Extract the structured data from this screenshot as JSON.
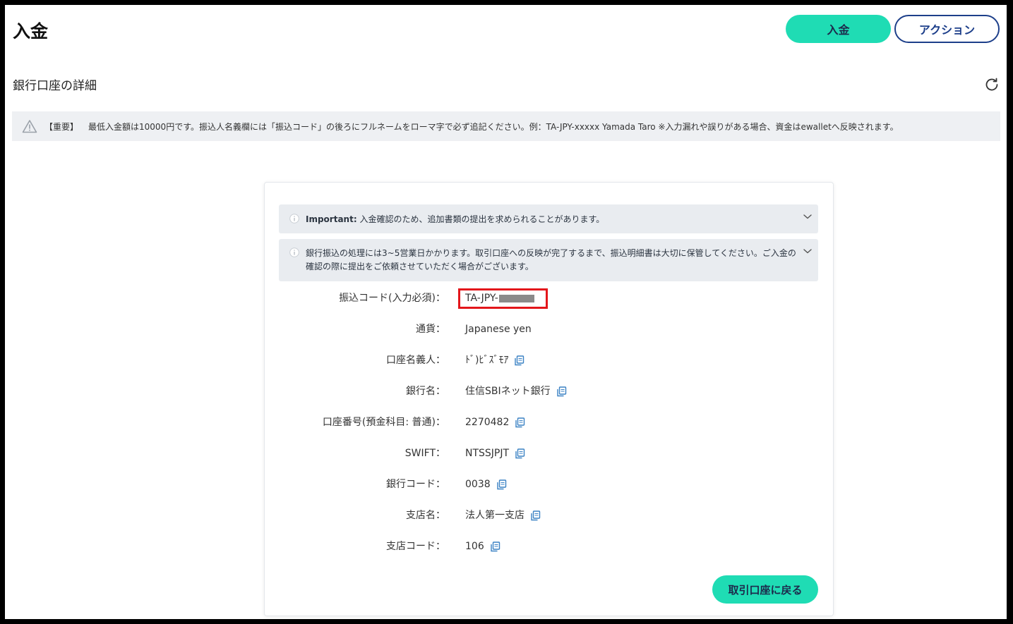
{
  "header": {
    "title": "入金",
    "deposit_button": "入金",
    "action_button": "アクション"
  },
  "section": {
    "title": "銀行口座の詳細"
  },
  "notice": {
    "label": "【重要】",
    "text": "最低入金額は10000円です。振込人名義欄には「振込コード」の後ろにフルネームをローマ字で必ず追記ください。例：TA-JPY-xxxxx Yamada Taro ※入力漏れや誤りがある場合、資金はewalletへ反映されます。"
  },
  "accordions": [
    {
      "bold": "Important:",
      "text": " 入金確認のため、追加書類の提出を求められることがあります。"
    },
    {
      "text": "銀行振込の処理には3~5営業日かかります。取引口座への反映が完了するまで、振込明細書は大切に保管してください。ご入金の確認の際に提出をご依頼させていただく場合がございます。"
    }
  ],
  "details": {
    "transfer_code_label": "振込コード(入力必須)：",
    "transfer_code_value": "TA-JPY-",
    "rows": [
      {
        "label": "通貨：",
        "value": "Japanese yen"
      },
      {
        "label": "口座名義人：",
        "value": "ﾄﾞ)ﾋﾞｽﾞﾓｱ"
      },
      {
        "label": "銀行名：",
        "value": "住信SBIネット銀行"
      },
      {
        "label": "口座番号(預金科目: 普通)：",
        "value": "2270482"
      },
      {
        "label": "SWIFT：",
        "value": "NTSSJPJT"
      },
      {
        "label": "銀行コード：",
        "value": "0038"
      },
      {
        "label": "支店名：",
        "value": "法人第一支店"
      },
      {
        "label": "支店コード：",
        "value": "106"
      }
    ]
  },
  "back_button": "取引口座に戻る",
  "colors": {
    "accent": "#1fdcb4",
    "navy": "#1d3f8a",
    "highlight": "#e3161b",
    "icon": "#3b82c4"
  }
}
